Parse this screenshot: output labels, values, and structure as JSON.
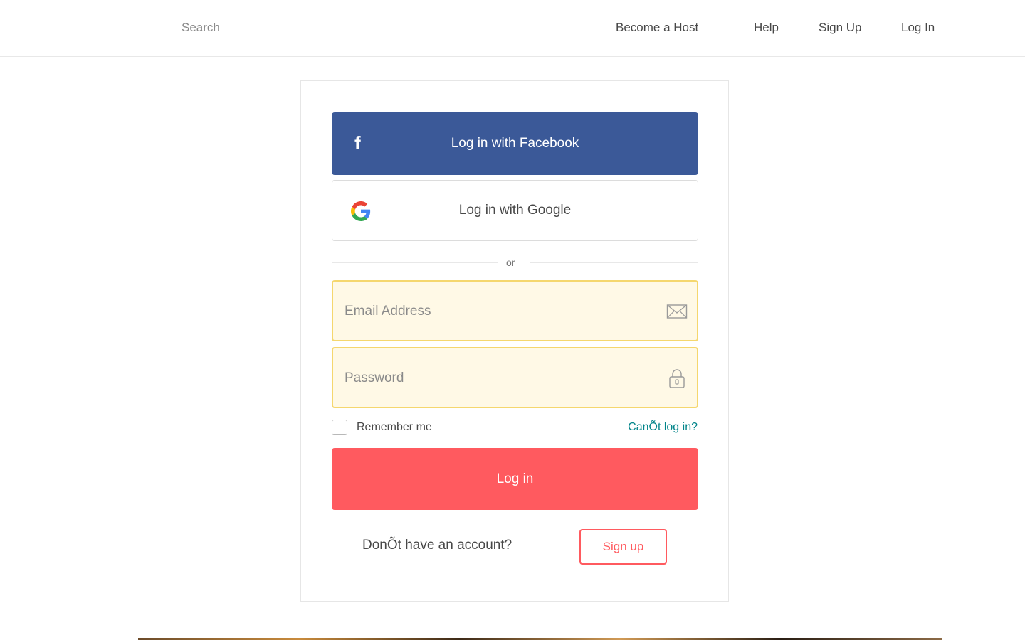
{
  "header": {
    "search_placeholder": "Search",
    "nav": {
      "become_host": "Become a Host",
      "help": "Help",
      "sign_up": "Sign Up",
      "log_in": "Log In"
    }
  },
  "login": {
    "facebook_label": "Log in with Facebook",
    "facebook_icon": "f",
    "google_label": "Log in with Google",
    "divider_text": "or",
    "email_placeholder": "Email Address",
    "password_placeholder": "Password",
    "remember_label": "Remember me",
    "cant_login": "CanÕt log in?",
    "submit_label": "Log in",
    "no_account": "DonÕt have an account?",
    "signup_label": "Sign up"
  },
  "colors": {
    "facebook": "#3b5998",
    "primary": "#ff5a5f",
    "link": "#008489",
    "field_bg": "#fff9e6",
    "field_border": "#f5d76e"
  }
}
